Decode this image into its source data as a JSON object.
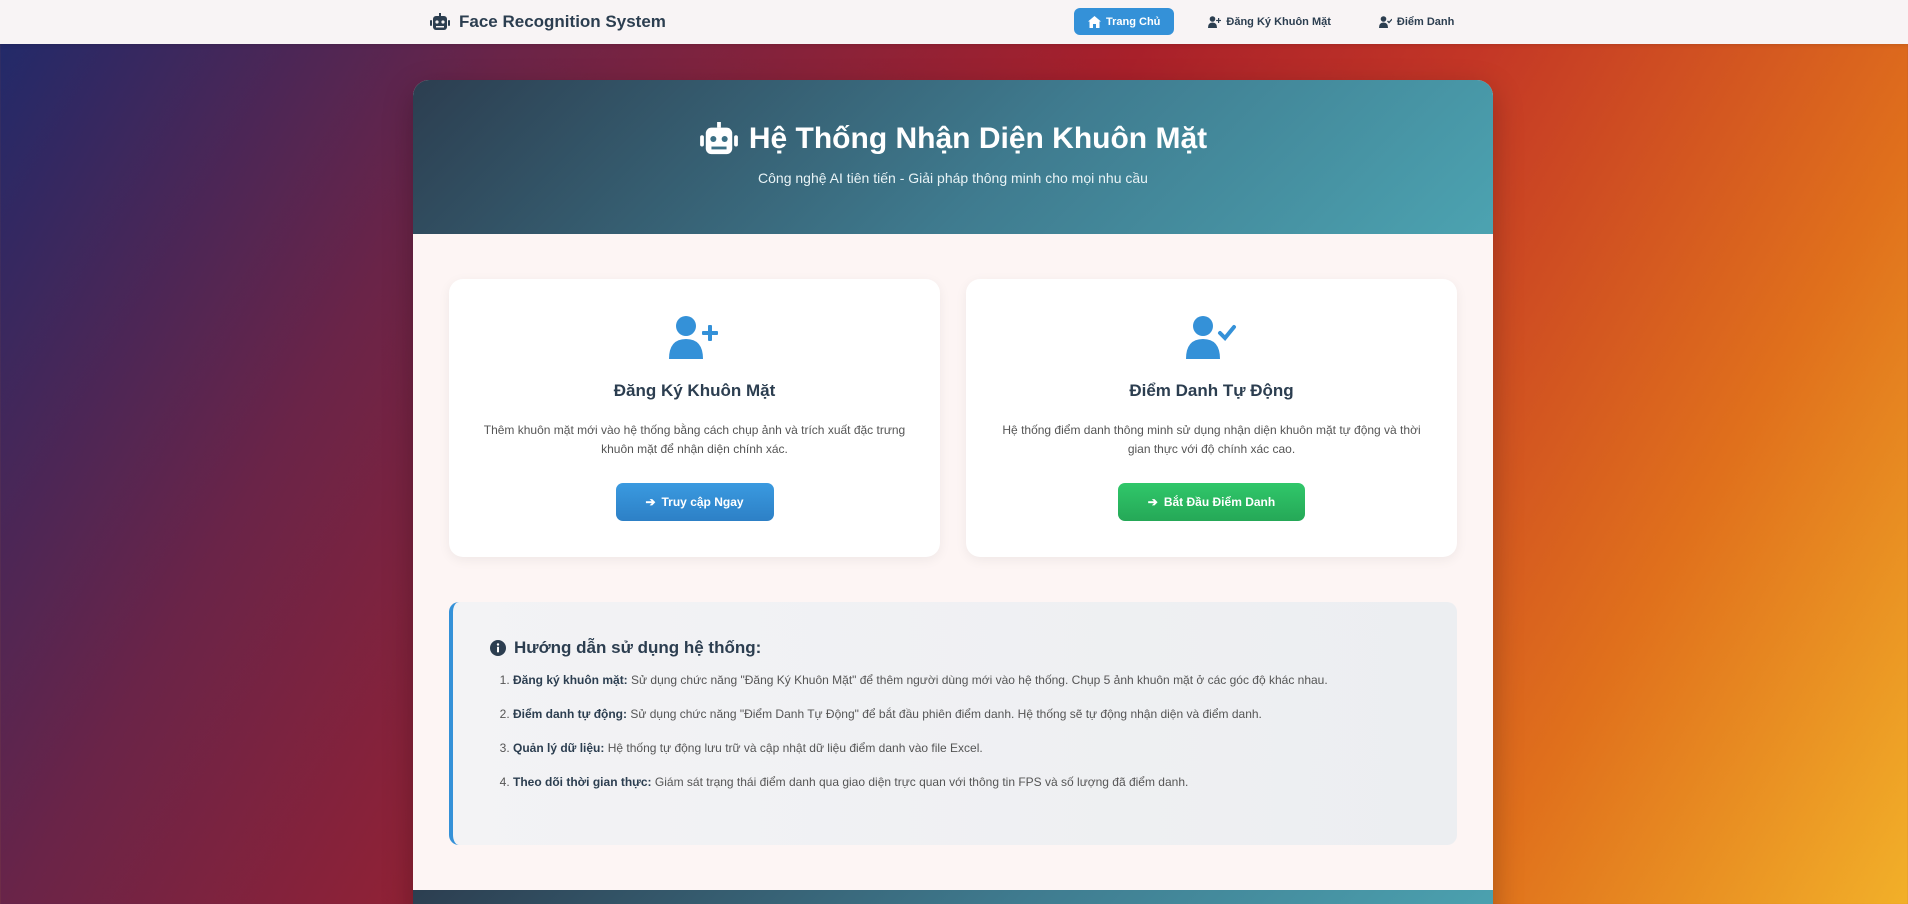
{
  "navbar": {
    "brand": "Face Recognition System",
    "items": [
      {
        "label": "Trang Chủ",
        "active": true
      },
      {
        "label": "Đăng Ký Khuôn Mặt",
        "active": false
      },
      {
        "label": "Điểm Danh",
        "active": false
      }
    ]
  },
  "hero": {
    "title": "Hệ Thống Nhận Diện Khuôn Mặt",
    "subtitle": "Công nghệ AI tiên tiến - Giải pháp thông minh cho mọi nhu cầu"
  },
  "features": [
    {
      "title": "Đăng Ký Khuôn Mặt",
      "description": "Thêm khuôn mặt mới vào hệ thống bằng cách chụp ảnh và trích xuất đặc trưng khuôn mặt để nhận diện chính xác.",
      "button": "Truy cập Ngay"
    },
    {
      "title": "Điểm Danh Tự Động",
      "description": "Hệ thống điểm danh thông minh sử dụng nhận diện khuôn mặt tự động và thời gian thực với độ chính xác cao.",
      "button": "Bắt Đầu Điểm Danh"
    }
  ],
  "guide": {
    "title": "Hướng dẫn sử dụng hệ thống:",
    "steps": [
      {
        "label": "Đăng ký khuôn mặt:",
        "text": "Sử dụng chức năng \"Đăng Ký Khuôn Mặt\" để thêm người dùng mới vào hệ thống. Chụp 5 ảnh khuôn mặt ở các góc độ khác nhau."
      },
      {
        "label": "Điểm danh tự động:",
        "text": "Sử dụng chức năng \"Điểm Danh Tự Động\" để bắt đầu phiên điểm danh. Hệ thống sẽ tự động nhận diện và điểm danh."
      },
      {
        "label": "Quản lý dữ liệu:",
        "text": "Hệ thống tự động lưu trữ và cập nhật dữ liệu điểm danh vào file Excel."
      },
      {
        "label": "Theo dõi thời gian thực:",
        "text": "Giám sát trạng thái điểm danh qua giao diện trực quan với thông tin FPS và số lượng đã điểm danh."
      }
    ]
  },
  "colors": {
    "primary": "#3491d8",
    "success": "#2ecc71",
    "dark": "#2c3e50"
  },
  "icons": {
    "brand": "robot-icon",
    "home": "home-icon",
    "register": "user-plus-icon",
    "attendance": "user-check-icon",
    "info": "info-circle-icon",
    "arrow": "arrow-right-icon"
  }
}
